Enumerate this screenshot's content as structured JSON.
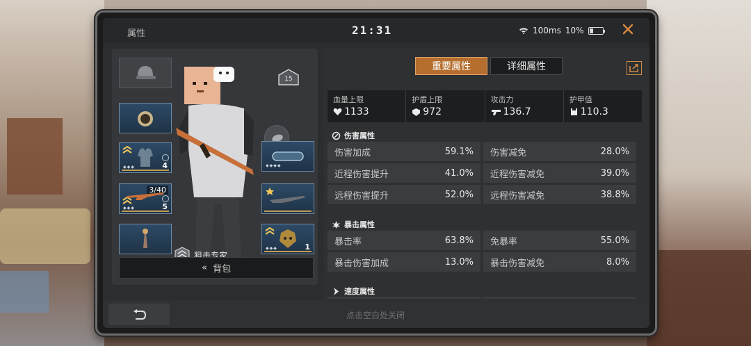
{
  "window": {
    "title": "属性",
    "time": "21:31",
    "ping": "100ms",
    "battery": "10%"
  },
  "equipment": {
    "level": "15",
    "weapon_primary_ammo": "3/40",
    "weapon_primary_count": "5",
    "armor_count": "4",
    "companion_count": "1",
    "role_label": "狙击专家",
    "backpack_label": "背包"
  },
  "tabs": [
    {
      "label": "重要属性",
      "active": true
    },
    {
      "label": "详细属性",
      "active": false
    }
  ],
  "summary": [
    {
      "label": "血量上限",
      "value": "1133",
      "icon": "heart-icon"
    },
    {
      "label": "护盾上限",
      "value": "972",
      "icon": "shield-icon"
    },
    {
      "label": "攻击力",
      "value": "136.7",
      "icon": "gun-icon"
    },
    {
      "label": "护甲值",
      "value": "110.3",
      "icon": "armor-icon"
    }
  ],
  "sections": {
    "damage": {
      "title": "伤害属性",
      "rows": [
        [
          {
            "name": "伤害加成",
            "value": "59.1%"
          },
          {
            "name": "伤害减免",
            "value": "28.0%"
          }
        ],
        [
          {
            "name": "近程伤害提升",
            "value": "41.0%"
          },
          {
            "name": "近程伤害减免",
            "value": "39.0%"
          }
        ],
        [
          {
            "name": "远程伤害提升",
            "value": "52.0%"
          },
          {
            "name": "远程伤害减免",
            "value": "38.8%"
          }
        ]
      ]
    },
    "crit": {
      "title": "暴击属性",
      "rows": [
        [
          {
            "name": "暴击率",
            "value": "63.8%"
          },
          {
            "name": "免暴率",
            "value": "55.0%"
          }
        ],
        [
          {
            "name": "暴击伤害加成",
            "value": "13.0%"
          },
          {
            "name": "暴击伤害减免",
            "value": "8.0%"
          }
        ]
      ]
    },
    "speed": {
      "title": "速度属性"
    }
  },
  "footer": {
    "hint": "点击空白处关闭"
  },
  "colors": {
    "accent": "#b56e2e",
    "panel": "#2f3032",
    "slot_blue": "#2d4a66"
  }
}
